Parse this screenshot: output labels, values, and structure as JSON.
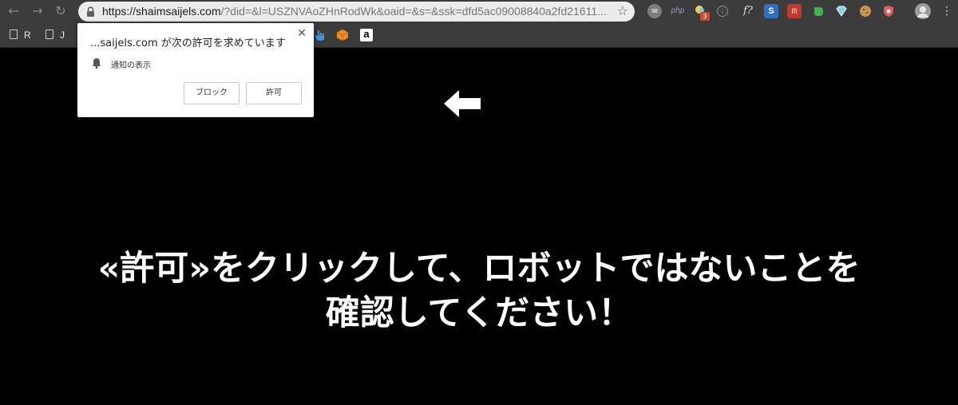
{
  "toolbar": {
    "url_host": "https://shaimsaijels.com",
    "url_path": "/?did=&l=USZNVAoZHnRodWk&oaid=&s=&ssk=dfd5ac09008840a2fd21611...",
    "extension_badge": "3",
    "extension_php_label": "php",
    "extension_f_label": "f?"
  },
  "bookmarks": {
    "items": [
      {
        "label": "R"
      },
      {
        "label": "J"
      }
    ]
  },
  "popup": {
    "title": "...saijels.com が次の許可を求めています",
    "permission": "通知の表示",
    "block_label": "ブロック",
    "allow_label": "許可"
  },
  "page": {
    "headline_line1": "«許可»をクリックして、ロボットではないことを",
    "headline_line2": "確認してください！"
  },
  "colors": {
    "toolbar": "#3c3c3c",
    "omnibox": "#ececec",
    "page_background": "#000000",
    "headline": "#ffffff"
  }
}
